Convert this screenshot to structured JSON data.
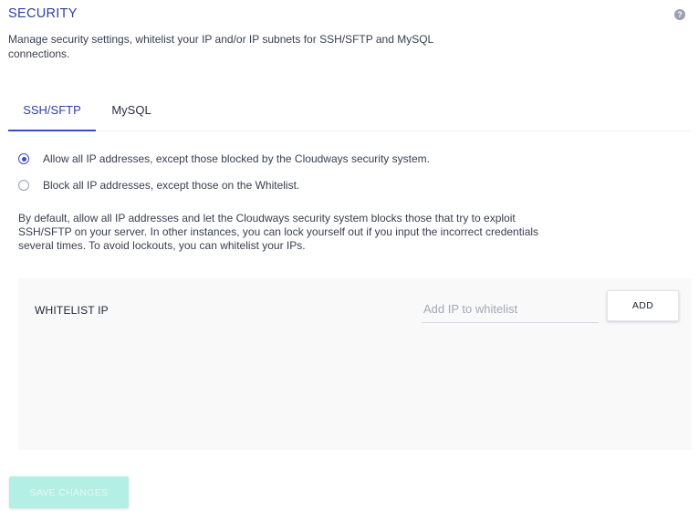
{
  "header": {
    "title": "SECURITY",
    "help_icon": "?",
    "description": "Manage security settings, whitelist your IP and/or IP subnets for SSH/SFTP and MySQL connections."
  },
  "tabs": [
    {
      "label": "SSH/SFTP",
      "active": true
    },
    {
      "label": "MySQL",
      "active": false
    }
  ],
  "access_options": [
    {
      "label": "Allow all IP addresses, except those blocked by the Cloudways security system.",
      "selected": true
    },
    {
      "label": "Block all IP addresses, except those on the Whitelist.",
      "selected": false
    }
  ],
  "info_text": "By default, allow all IP addresses and let the Cloudways security system blocks those that try to exploit SSH/SFTP on your server. In other instances, you can lock yourself out if you input the incorrect credentials several times. To avoid lockouts, you can whitelist your IPs.",
  "whitelist": {
    "title": "WHITELIST IP",
    "input_placeholder": "Add IP to whitelist",
    "input_value": "",
    "add_label": "ADD",
    "entries": []
  },
  "footer": {
    "save_label": "SAVE CHANGES",
    "save_disabled": true
  },
  "colors": {
    "accent": "#3a4dbf",
    "title": "#2e3fa5",
    "save_button_disabled": "#b3efe4",
    "panel_background": "#f9f9fa"
  },
  "icons": {
    "help": "help-icon"
  }
}
